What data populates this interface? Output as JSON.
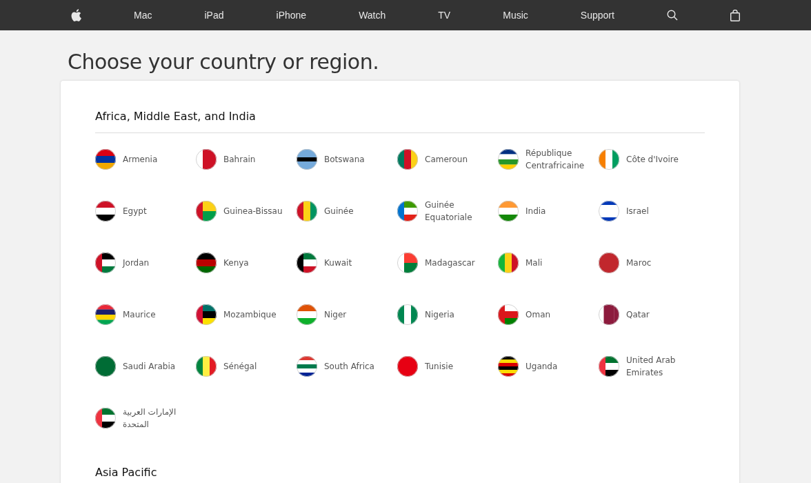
{
  "nav": {
    "items": [
      "Mac",
      "iPad",
      "iPhone",
      "Watch",
      "TV",
      "Music",
      "Support"
    ]
  },
  "title": "Choose your country or region.",
  "sections": [
    {
      "heading": "Africa, Middle East, and India",
      "countries": [
        "Armenia",
        "Bahrain",
        "Botswana",
        "Cameroun",
        "République Centrafricaine",
        "Côte d'Ivoire",
        "Egypt",
        "Guinea-Bissau",
        "Guinée",
        "Guinée Equatoriale",
        "India",
        "Israel",
        "Jordan",
        "Kenya",
        "Kuwait",
        "Madagascar",
        "Mali",
        "Maroc",
        "Maurice",
        "Mozambique",
        "Niger",
        "Nigeria",
        "Oman",
        "Qatar",
        "Saudi Arabia",
        "Sénégal",
        "South Africa",
        "Tunisie",
        "Uganda",
        "United Arab Emirates",
        "الإمارات العربية المتحدة"
      ]
    },
    {
      "heading": "Asia Pacific"
    }
  ]
}
